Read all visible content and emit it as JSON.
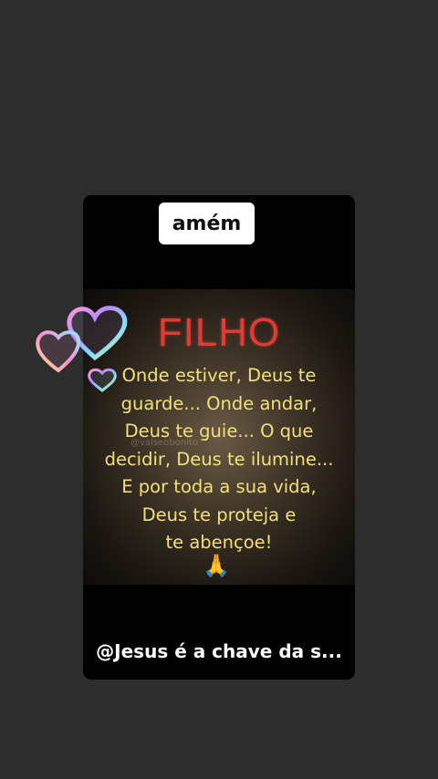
{
  "sticker": {
    "label": "amém"
  },
  "image": {
    "title": "FILHO",
    "watermark": "@valseobonito",
    "lines": [
      "Onde estiver, Deus te",
      "guarde... Onde andar,",
      "Deus te guie... O que",
      "decidir, Deus te ilumine...",
      "E por toda a sua vida,",
      "Deus te proteja e",
      "te abençoe!"
    ],
    "emoji": "🙏"
  },
  "caption": {
    "text": "@Jesus é a chave da s..."
  },
  "colors": {
    "background": "#2e2d2e",
    "card": "#000000",
    "title": "#e33a35",
    "message": "#f2e07a"
  },
  "icons": [
    "hearts-sticker-icon",
    "praying-hands-icon"
  ]
}
